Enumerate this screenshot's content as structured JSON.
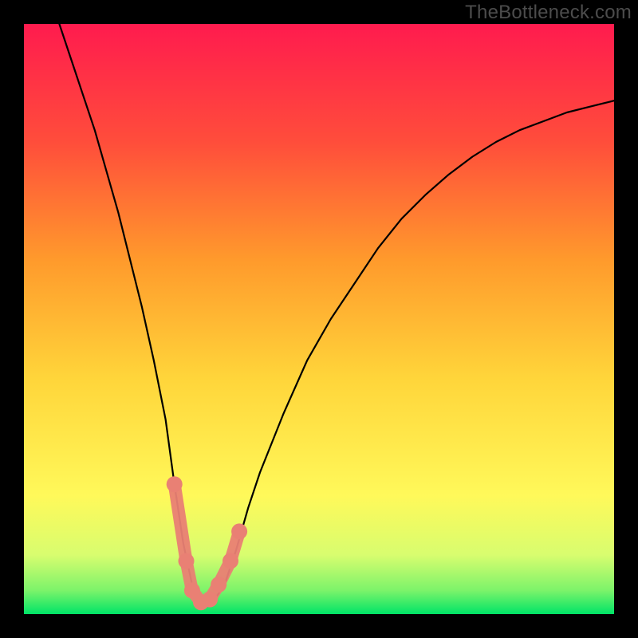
{
  "watermark": "TheBottleneck.com",
  "chart_data": {
    "type": "line",
    "title": "",
    "xlabel": "",
    "ylabel": "",
    "xlim": [
      0,
      100
    ],
    "ylim": [
      0,
      100
    ],
    "background": {
      "description": "Vertical gradient representing bottleneck severity: red (bad) at top to green (good) at bottom, with a bright green band at the very bottom.",
      "stops": [
        {
          "offset": 0,
          "color": "#ff1b4e"
        },
        {
          "offset": 20,
          "color": "#ff4d3b"
        },
        {
          "offset": 40,
          "color": "#ff9a2c"
        },
        {
          "offset": 60,
          "color": "#ffd53a"
        },
        {
          "offset": 80,
          "color": "#fff95a"
        },
        {
          "offset": 90,
          "color": "#d8fd6f"
        },
        {
          "offset": 96,
          "color": "#7cf36a"
        },
        {
          "offset": 100,
          "color": "#00e467"
        }
      ]
    },
    "series": [
      {
        "name": "bottleneck-curve",
        "color": "#000000",
        "x": [
          6,
          8,
          10,
          12,
          14,
          16,
          18,
          20,
          22,
          24,
          25.5,
          27,
          28.5,
          30,
          32,
          34,
          36,
          38,
          40,
          44,
          48,
          52,
          56,
          60,
          64,
          68,
          72,
          76,
          80,
          84,
          88,
          92,
          96,
          100
        ],
        "values": [
          100,
          94,
          88,
          82,
          75,
          68,
          60,
          52,
          43,
          33,
          22,
          12,
          5,
          2,
          2,
          5,
          11,
          18,
          24,
          34,
          43,
          50,
          56,
          62,
          67,
          71,
          74.5,
          77.5,
          80,
          82,
          83.5,
          85,
          86,
          87
        ]
      }
    ],
    "markers": {
      "name": "highlight-segment",
      "description": "Pink bead-like markers near the minimum of the curve",
      "color": "#e98074",
      "points": [
        {
          "x": 25.5,
          "y": 22
        },
        {
          "x": 27.5,
          "y": 9
        },
        {
          "x": 28.5,
          "y": 4
        },
        {
          "x": 30,
          "y": 2
        },
        {
          "x": 31.5,
          "y": 2.5
        },
        {
          "x": 33,
          "y": 5
        },
        {
          "x": 35,
          "y": 9
        },
        {
          "x": 36.5,
          "y": 14
        }
      ]
    }
  }
}
